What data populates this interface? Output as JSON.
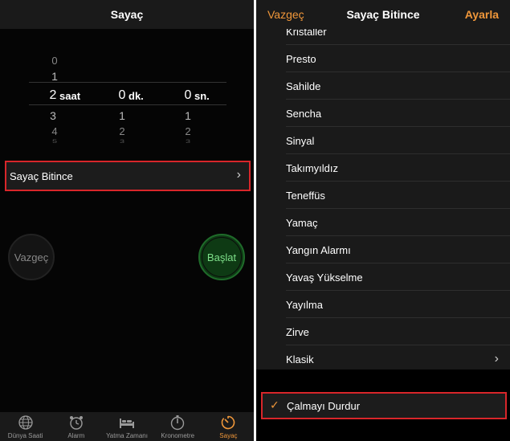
{
  "left": {
    "nav_title": "Sayaç",
    "picker": {
      "hours": {
        "above": [
          "0",
          "1"
        ],
        "selected": "2",
        "below": [
          "3",
          "4",
          "5"
        ],
        "unit": "saat"
      },
      "minutes": {
        "selected": "0",
        "below": [
          "1",
          "2",
          "3"
        ],
        "unit": "dk."
      },
      "seconds": {
        "selected": "0",
        "below": [
          "1",
          "2",
          "3"
        ],
        "unit": "sn."
      }
    },
    "when_timer_ends_label": "Sayaç Bitince",
    "cancel_label": "Vazgeç",
    "start_label": "Başlat",
    "tabs": [
      {
        "label": "Dünya Saati",
        "icon": "globe-icon"
      },
      {
        "label": "Alarm",
        "icon": "alarm-clock-icon"
      },
      {
        "label": "Yatma Zamanı",
        "icon": "bed-icon"
      },
      {
        "label": "Kronometre",
        "icon": "stopwatch-icon"
      },
      {
        "label": "Sayaç",
        "icon": "timer-icon",
        "active": true
      }
    ]
  },
  "right": {
    "cancel_label": "Vazgeç",
    "title": "Sayaç Bitince",
    "set_label": "Ayarla",
    "sounds": [
      "Kristaller",
      "Presto",
      "Sahilde",
      "Sencha",
      "Sinyal",
      "Takımyıldız",
      "Teneffüs",
      "Yamaç",
      "Yangın Alarmı",
      "Yavaş Yükselme",
      "Yayılma",
      "Zirve",
      "Klasik"
    ],
    "stop_playing_label": "Çalmayı Durdur",
    "check": "✓"
  },
  "colors": {
    "accent": "#f0973a",
    "highlight": "#d8262a",
    "start_green": "#7ee08a"
  }
}
